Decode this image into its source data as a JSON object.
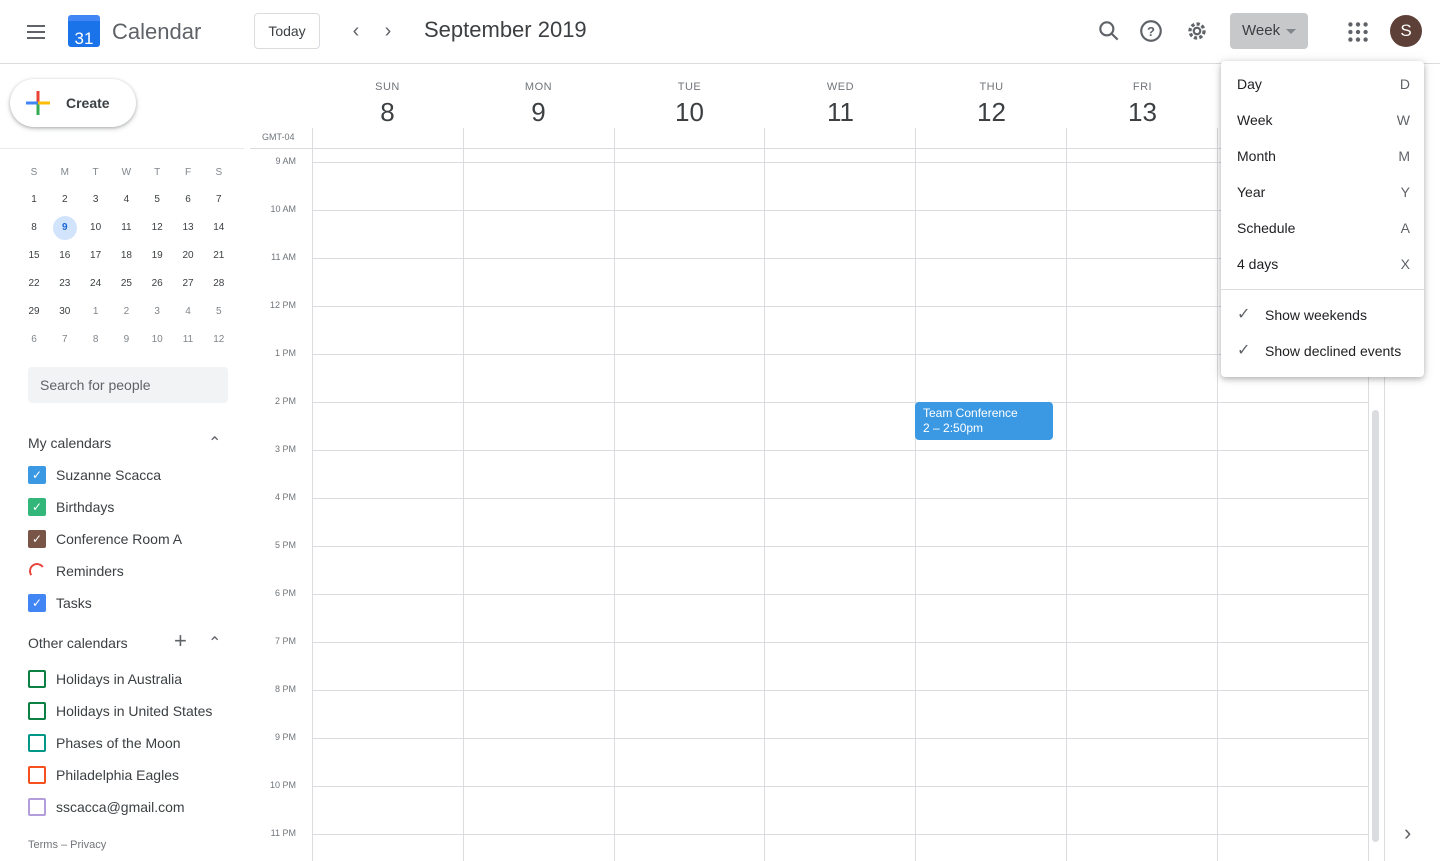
{
  "header": {
    "app_title": "Calendar",
    "logo_day": "31",
    "today_label": "Today",
    "period": "September 2019",
    "view_label": "Week",
    "avatar_initial": "S"
  },
  "create_label": "Create",
  "mini_calendar": {
    "weekdays": [
      "S",
      "M",
      "T",
      "W",
      "T",
      "F",
      "S"
    ],
    "weeks": [
      [
        "1",
        "2",
        "3",
        "4",
        "5",
        "6",
        "7"
      ],
      [
        "8",
        "9",
        "10",
        "11",
        "12",
        "13",
        "14"
      ],
      [
        "15",
        "16",
        "17",
        "18",
        "19",
        "20",
        "21"
      ],
      [
        "22",
        "23",
        "24",
        "25",
        "26",
        "27",
        "28"
      ],
      [
        "29",
        "30",
        "1",
        "2",
        "3",
        "4",
        "5"
      ],
      [
        "6",
        "7",
        "8",
        "9",
        "10",
        "11",
        "12"
      ]
    ],
    "selected": "9"
  },
  "search_placeholder": "Search for people",
  "my_calendars": {
    "title": "My calendars",
    "items": [
      {
        "label": "Suzanne Scacca",
        "color": "#3b99e3",
        "checked": true
      },
      {
        "label": "Birthdays",
        "color": "#33b679",
        "checked": true
      },
      {
        "label": "Conference Room A",
        "color": "#795548",
        "checked": true
      },
      {
        "label": "Reminders",
        "color": "#e8453c",
        "checked": false,
        "loading": true
      },
      {
        "label": "Tasks",
        "color": "#4285f4",
        "checked": true
      }
    ]
  },
  "other_calendars": {
    "title": "Other calendars",
    "items": [
      {
        "label": "Holidays in Australia",
        "color": "#0b8043",
        "checked": false
      },
      {
        "label": "Holidays in United States",
        "color": "#0b8043",
        "checked": false
      },
      {
        "label": "Phases of the Moon",
        "color": "#009688",
        "checked": false
      },
      {
        "label": "Philadelphia Eagles",
        "color": "#f4511e",
        "checked": false
      },
      {
        "label": "sscacca@gmail.com",
        "color": "#b39ddb",
        "checked": false
      }
    ]
  },
  "footer": "Terms – Privacy",
  "week": {
    "timezone": "GMT-04",
    "days": [
      {
        "dow": "SUN",
        "num": "8"
      },
      {
        "dow": "MON",
        "num": "9"
      },
      {
        "dow": "TUE",
        "num": "10"
      },
      {
        "dow": "WED",
        "num": "11"
      },
      {
        "dow": "THU",
        "num": "12"
      },
      {
        "dow": "FRI",
        "num": "13"
      }
    ],
    "hours": [
      "9 AM",
      "10 AM",
      "11 AM",
      "12 PM",
      "1 PM",
      "2 PM",
      "3 PM",
      "4 PM",
      "5 PM",
      "6 PM",
      "7 PM",
      "8 PM",
      "9 PM",
      "10 PM",
      "11 PM"
    ]
  },
  "event": {
    "title": "Team Conference",
    "time": "2 – 2:50pm",
    "color": "#3b99e3"
  },
  "view_menu": {
    "views": [
      {
        "label": "Day",
        "key": "D"
      },
      {
        "label": "Week",
        "key": "W"
      },
      {
        "label": "Month",
        "key": "M"
      },
      {
        "label": "Year",
        "key": "Y"
      },
      {
        "label": "Schedule",
        "key": "A"
      },
      {
        "label": "4 days",
        "key": "X"
      }
    ],
    "options": [
      {
        "label": "Show weekends",
        "checked": true
      },
      {
        "label": "Show declined events",
        "checked": true
      }
    ]
  }
}
